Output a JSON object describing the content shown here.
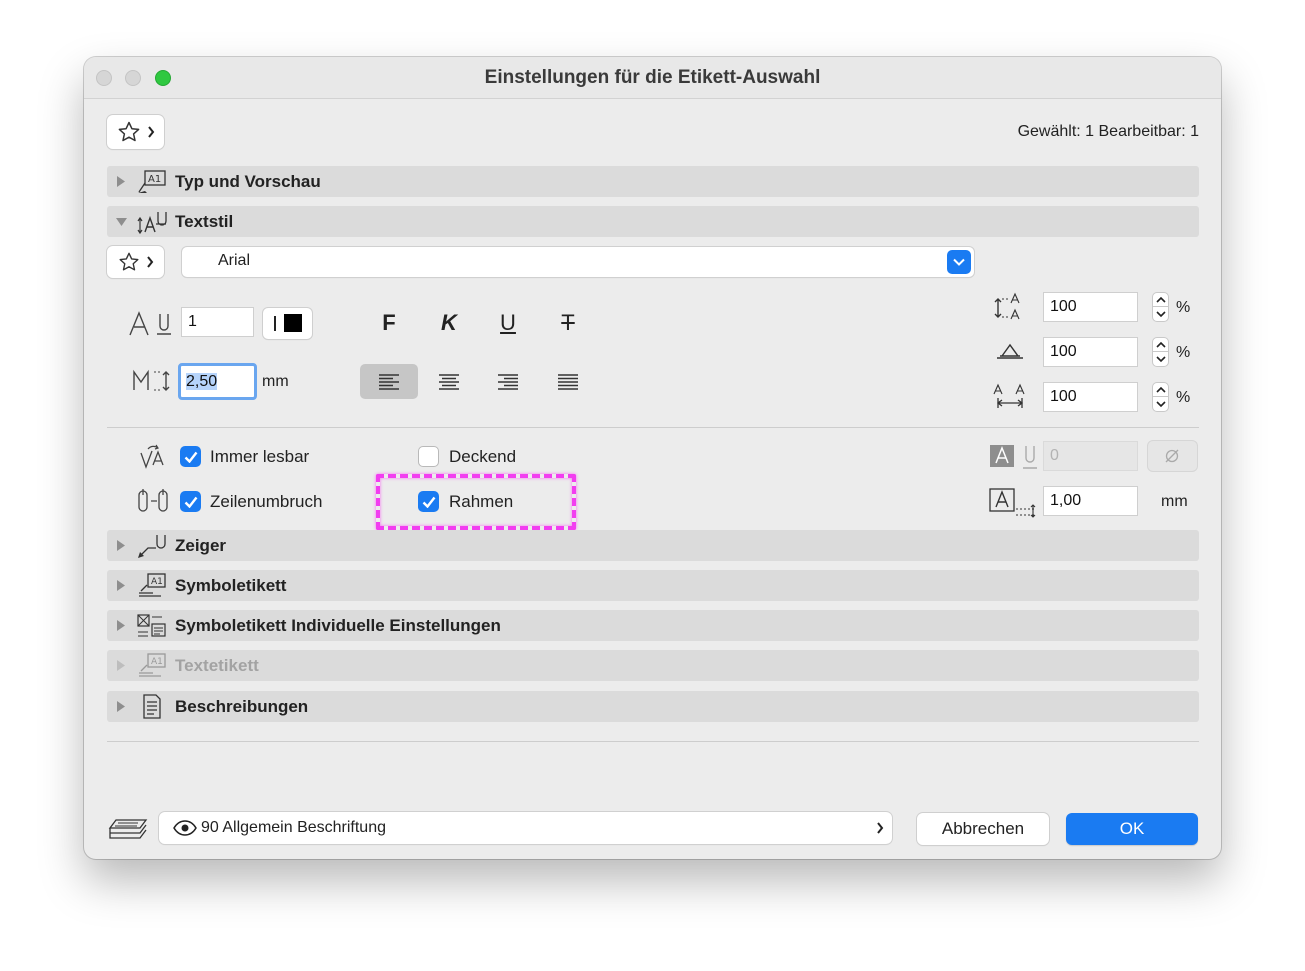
{
  "window": {
    "title": "Einstellungen für die Etikett-Auswahl"
  },
  "header": {
    "selection_info": "Gewählt: 1 Bearbeitbar: 1"
  },
  "sections": [
    {
      "label": "Typ und Vorschau",
      "expanded": false,
      "icon": "label-preview-icon"
    },
    {
      "label": "Textstil",
      "expanded": true,
      "icon": "text-style-icon"
    },
    {
      "label": "Zeiger",
      "expanded": false,
      "icon": "pointer-icon"
    },
    {
      "label": "Symboletikett",
      "expanded": false,
      "icon": "symbol-label-icon"
    },
    {
      "label": "Symboletikett Individuelle Einstellungen",
      "expanded": false,
      "icon": "symbol-label-custom-icon"
    },
    {
      "label": "Textetikett",
      "expanded": false,
      "disabled": true,
      "icon": "text-label-icon"
    },
    {
      "label": "Beschreibungen",
      "expanded": false,
      "icon": "descriptions-icon"
    }
  ],
  "textstyle": {
    "font": "Arial",
    "pen": "1",
    "size": "2,50",
    "size_unit": "mm",
    "styles": [
      "F",
      "K",
      "U",
      "T"
    ],
    "alignment_selected": "left",
    "width_factor": "100",
    "width_unit": "%",
    "slant": "100",
    "slant_unit": "%",
    "spacing": "100",
    "spacing_unit": "%"
  },
  "options": {
    "immer_lesbar": {
      "label": "Immer lesbar",
      "checked": true
    },
    "zeilenumbruch": {
      "label": "Zeilenumbruch",
      "checked": true
    },
    "deckend": {
      "label": "Deckend",
      "checked": false
    },
    "rahmen": {
      "label": "Rahmen",
      "checked": true
    },
    "background_pen": "0",
    "frame_offset": "1,00",
    "frame_offset_unit": "mm"
  },
  "highlight_color": "#f23df0",
  "accent_color": "#1a7bf2",
  "footer": {
    "layer": "90 Allgemein Beschriftung",
    "cancel_label": "Abbrechen",
    "ok_label": "OK"
  }
}
